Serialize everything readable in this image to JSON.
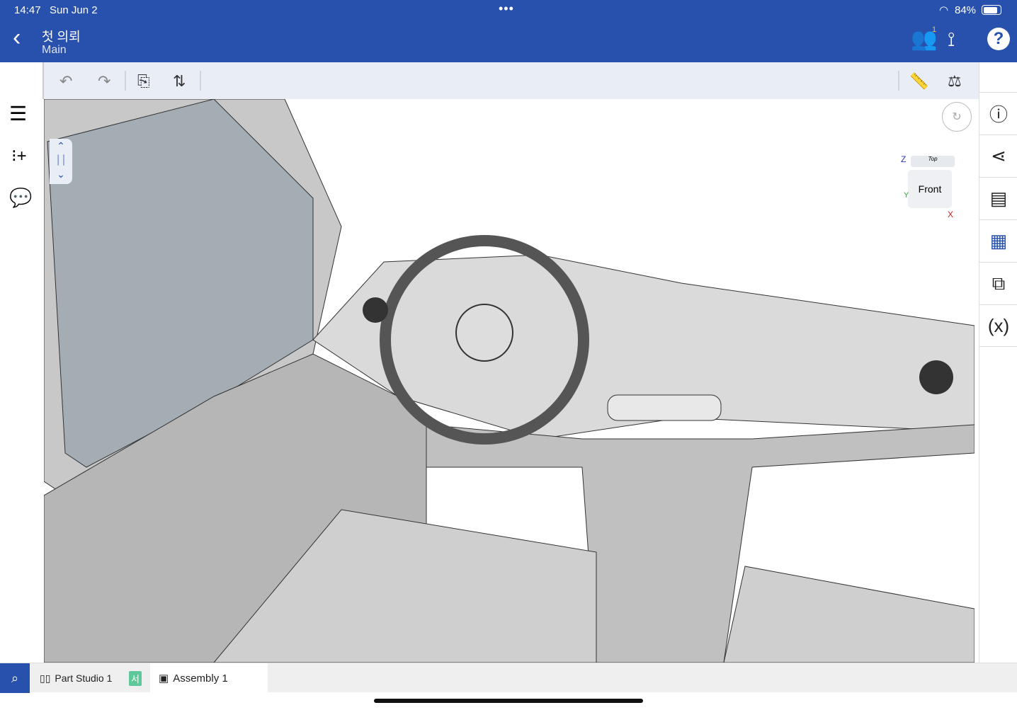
{
  "status": {
    "time": "14:47",
    "date": "Sun Jun 2",
    "battery": "84%",
    "battery_level": 84
  },
  "header": {
    "title": "첫 의뢰",
    "subtitle": "Main",
    "collaborators_badge": "1"
  },
  "viewcube": {
    "top": "Top",
    "front": "Front",
    "axis_x": "X",
    "axis_y": "Y",
    "axis_z": "Z"
  },
  "tabs": [
    {
      "label": "Part Studio 1",
      "badge": "서"
    },
    {
      "label": "Assembly 1"
    }
  ],
  "colors": {
    "brand": "#2751ad",
    "badge": "#5dc99a"
  }
}
